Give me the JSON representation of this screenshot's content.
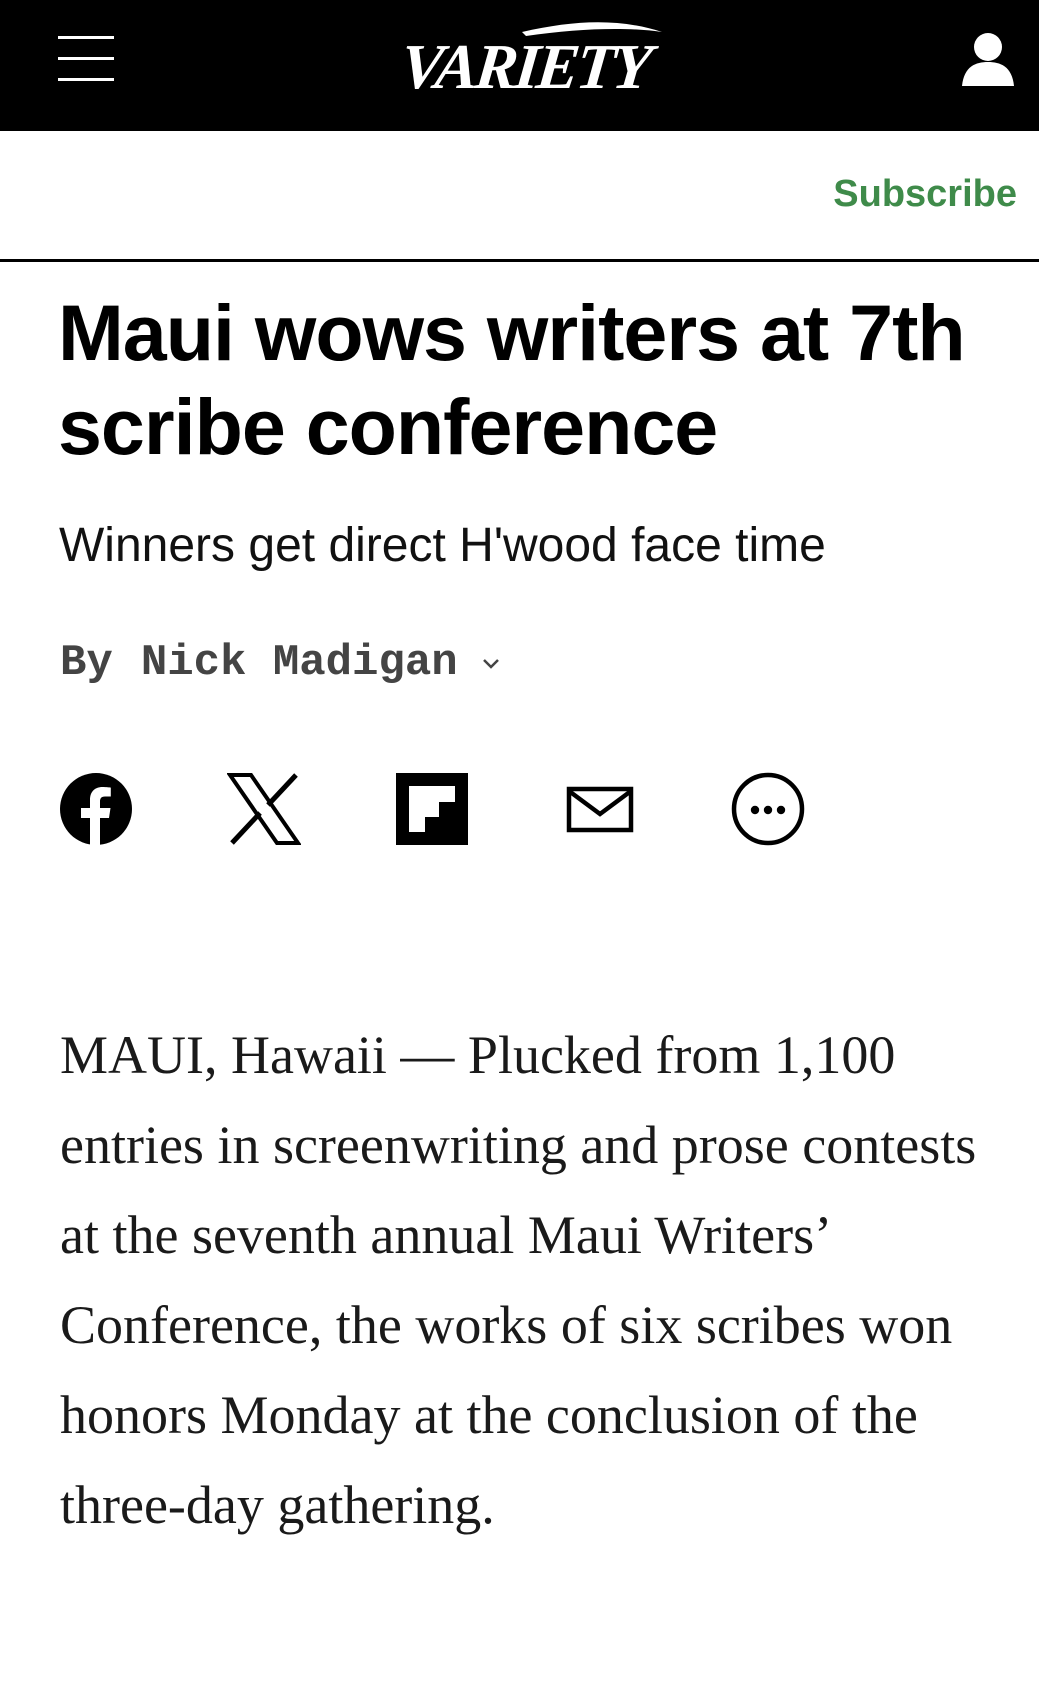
{
  "header": {
    "logo_text": "VARIETY",
    "menu_icon": "hamburger-menu-icon",
    "account_icon": "user-account-icon"
  },
  "subscribe": {
    "label": "Subscribe",
    "color": "#3f8b4a"
  },
  "article": {
    "headline": "Maui wows writers at 7th scribe conference",
    "dek": "Winners get direct H'wood face time",
    "byline_prefix": "By",
    "author": "Nick Madigan",
    "body": "MAUI, Hawaii — Plucked from 1,100 entries in screenwriting and prose contests at the seventh annual Maui Writers’ Conference, the works of six scribes won honors Monday at the conclusion of the three-day gathering."
  },
  "share": {
    "icons": [
      "facebook-icon",
      "x-icon",
      "flipboard-icon",
      "email-icon",
      "more-icon"
    ]
  }
}
